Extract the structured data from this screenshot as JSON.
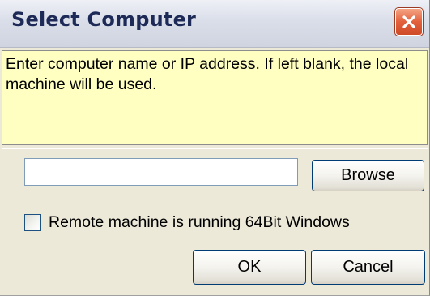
{
  "window": {
    "title": "Select Computer"
  },
  "info": {
    "message": "Enter computer name or IP address. If left blank, the local machine will be used."
  },
  "computer_input": {
    "value": "",
    "placeholder": ""
  },
  "buttons": {
    "browse": "Browse",
    "ok": "OK",
    "cancel": "Cancel"
  },
  "checkbox": {
    "label": "Remote machine is running 64Bit Windows",
    "checked": false
  },
  "icons": {
    "close": "close-icon"
  },
  "colors": {
    "info_background": "#ffffc1",
    "close_button": "#e2603c",
    "title_text": "#1d2a57"
  }
}
